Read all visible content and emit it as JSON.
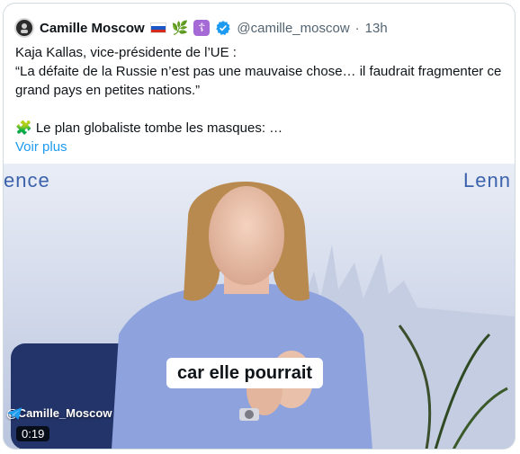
{
  "tweet": {
    "author": "Camille Moscow",
    "handle": "@camille_moscow",
    "dot": "·",
    "time": "13h",
    "emoji_badge": "🌿",
    "cross_badge": "☦",
    "text_lines": [
      "Kaja Kallas, vice-présidente de l’UE :",
      "“La défaite de la Russie n’est pas une mauvaise chose… il faudrait fragmenter ce grand pays en  petites nations.”",
      "🧩 Le plan globaliste tombe les masques: …"
    ],
    "show_more": "Voir plus"
  },
  "video": {
    "watermark_left": "ence",
    "watermark_right": "Lenn",
    "caption": "car elle pourrait",
    "channel": "@Camille_Moscow",
    "duration": "0:19"
  },
  "colors": {
    "link": "#1d9bf0",
    "secondary_text": "#536471",
    "verified": "#1d9bf0",
    "border": "#cfd9de"
  }
}
